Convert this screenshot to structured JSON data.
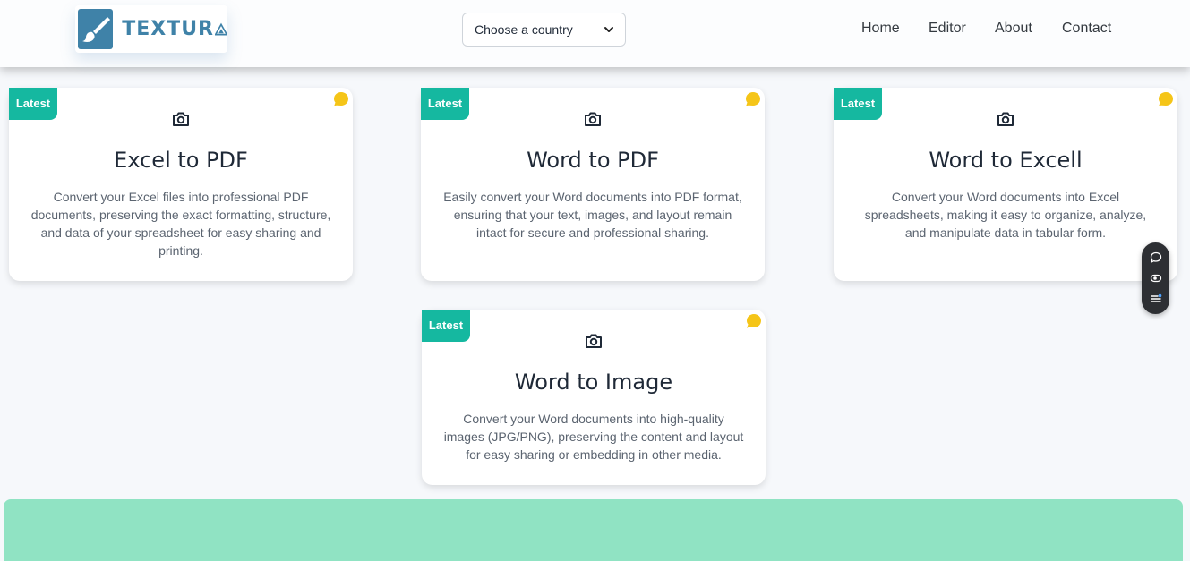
{
  "header": {
    "logo_text": "TEXTUR",
    "country_select": {
      "value": "Choose a country"
    },
    "nav": [
      {
        "label": "Home"
      },
      {
        "label": "Editor"
      },
      {
        "label": "About"
      },
      {
        "label": "Contact"
      }
    ]
  },
  "cards": [
    {
      "badge": "Latest",
      "title": "Excel to PDF",
      "description": "Convert your Excel files into professional PDF documents, preserving the exact formatting, structure, and data of your spreadsheet for easy sharing and printing."
    },
    {
      "badge": "Latest",
      "title": "Word to PDF",
      "description": "Easily convert your Word documents into PDF format, ensuring that your text, images, and layout remain intact for secure and professional sharing."
    },
    {
      "badge": "Latest",
      "title": "Word to Excell",
      "description": "Convert your Word documents into Excel spreadsheets, making it easy to organize, analyze, and manipulate data in tabular form."
    },
    {
      "badge": "Latest",
      "title": "Word to Image",
      "description": "Convert your Word documents into high-quality images (JPG/PNG), preserving the content and layout for easy sharing or embedding in other media."
    }
  ],
  "colors": {
    "brand": "#3f82a8",
    "badge": "#15b8a0",
    "dot": "#f5c518",
    "footer": "#90e3c3"
  },
  "icons": {
    "logo": "paintbrush-icon",
    "card": "camera-icon",
    "corner": "chat-bubble-icon",
    "toolbar": [
      "comment-icon",
      "eye-icon",
      "list-icon"
    ]
  }
}
